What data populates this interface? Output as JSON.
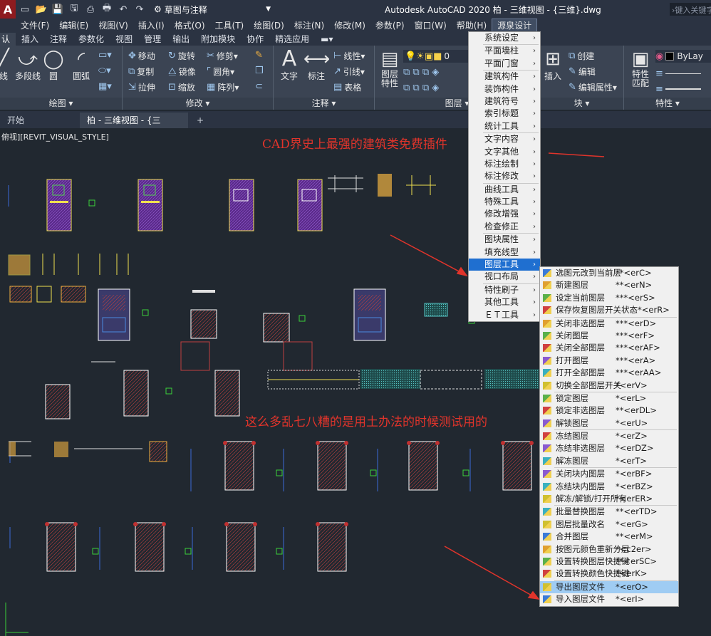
{
  "titlebar": {
    "logo_text": "A",
    "quick_access": [
      "new-icon",
      "open-icon",
      "save-icon",
      "saveas-icon",
      "plot-icon",
      "print-icon",
      "undo-icon",
      "redo-icon"
    ],
    "workspace": "草图与注释",
    "app_title": "Autodesk AutoCAD 2020    柏 - 三维视图 - {三维}.dwg",
    "search_placeholder": "键入关键字"
  },
  "menubar": [
    "文件(F)",
    "编辑(E)",
    "视图(V)",
    "插入(I)",
    "格式(O)",
    "工具(T)",
    "绘图(D)",
    "标注(N)",
    "修改(M)",
    "参数(P)",
    "窗口(W)",
    "帮助(H)",
    "源泉设计"
  ],
  "ribbon_tabs": [
    "认",
    "插入",
    "注释",
    "参数化",
    "视图",
    "管理",
    "输出",
    "附加模块",
    "协作",
    "精选应用"
  ],
  "ribbon": {
    "draw": {
      "title": "绘图",
      "items": [
        "线",
        "多段线",
        "圆",
        "圆弧"
      ]
    },
    "modify": {
      "title": "修改",
      "rows": [
        [
          "移动",
          "旋转",
          "修剪"
        ],
        [
          "复制",
          "镜像",
          "圆角"
        ],
        [
          "拉伸",
          "缩放",
          "阵列"
        ]
      ]
    },
    "annotation": {
      "title": "注释",
      "items": [
        "文字",
        "标注"
      ],
      "small": [
        "线性",
        "引线",
        "表格"
      ]
    },
    "layers": {
      "title": "图层",
      "props_label": "图层\n特性",
      "layer_value": "0"
    },
    "block": {
      "title": "块",
      "insert": "插入",
      "items": [
        "创建",
        "编辑",
        "编辑属性"
      ]
    },
    "properties": {
      "title": "特性",
      "match": "特性\n匹配",
      "bylayer": "ByLay"
    }
  },
  "doc_tabs": [
    "开始",
    "柏 - 三维视图 - {三维}*",
    "+"
  ],
  "canvas": {
    "view_label": "俯视][REVIT_VISUAL_STYLE]",
    "annotation_top": "CAD界史上最强的建筑类免费插件",
    "annotation_mid": "这么多乱七八糟的是用土办法的时候测试用的"
  },
  "menu_main": [
    [
      "系统设定"
    ],
    [
      "平面墙柱",
      "平面门窗"
    ],
    [
      "建筑构件",
      "装饰构件",
      "建筑符号",
      "索引标题",
      "统计工具"
    ],
    [
      "文字内容",
      "文字其他",
      "标注绘制",
      "标注修改"
    ],
    [
      "曲线工具",
      "特殊工具",
      "修改增强",
      "检查修正"
    ],
    [
      "图块属性",
      "填充线型",
      "图层工具",
      "视口布局"
    ],
    [
      "特性刷子",
      "其他工具",
      "ＥＴ工具"
    ]
  ],
  "menu_layer": [
    [
      {
        "label": "选图元改到当前层",
        "key": "**<erC>"
      },
      {
        "label": "新建图层",
        "key": "**<erN>"
      },
      {
        "label": "设定当前图层",
        "key": "***<erS>"
      },
      {
        "label": "保存恢复图层开关状态*<erR>",
        "key": ""
      }
    ],
    [
      {
        "label": "关闭非选图层",
        "key": "***<erD>"
      },
      {
        "label": "关闭图层",
        "key": "***<erF>"
      },
      {
        "label": "关闭全部图层",
        "key": "***<erAF>"
      },
      {
        "label": "打开图层",
        "key": "***<erA>"
      },
      {
        "label": "打开全部图层",
        "key": "***<erAA>"
      },
      {
        "label": "切换全部图层开关",
        "key": "*<erV>"
      }
    ],
    [
      {
        "label": "锁定图层",
        "key": "*<erL>"
      },
      {
        "label": "锁定非选图层",
        "key": "**<erDL>"
      },
      {
        "label": "解锁图层",
        "key": "*<erU>"
      }
    ],
    [
      {
        "label": "冻结图层",
        "key": "*<erZ>"
      },
      {
        "label": "冻结非选图层",
        "key": "*<erDZ>"
      },
      {
        "label": "解冻图层",
        "key": "*<erT>"
      }
    ],
    [
      {
        "label": "关闭块内图层",
        "key": "*<erBF>"
      },
      {
        "label": "冻结块内图层",
        "key": "*<erBZ>"
      },
      {
        "label": "解冻/解锁/打开所有",
        "key": "*<erER>"
      }
    ],
    [
      {
        "label": "批量替换图层",
        "key": "**<erTD>"
      },
      {
        "label": "图层批量改名",
        "key": "*<erG>"
      },
      {
        "label": "合并图层",
        "key": "**<erM>"
      },
      {
        "label": "按图元颜色重新分层",
        "key": "*<c2er>"
      },
      {
        "label": "设置转换图层快捷键",
        "key": "**<erSC>"
      },
      {
        "label": "设置转换颜色快捷键",
        "key": "*<erK>"
      }
    ],
    [
      {
        "label": "导出图层文件",
        "key": "*<erO>"
      },
      {
        "label": "导入图层文件",
        "key": "*<erI>"
      }
    ]
  ],
  "colors": {
    "accent": "#1f6fd0",
    "annotation": "#e0342b",
    "canvas": "#212830",
    "ribbon": "#3b4453"
  }
}
